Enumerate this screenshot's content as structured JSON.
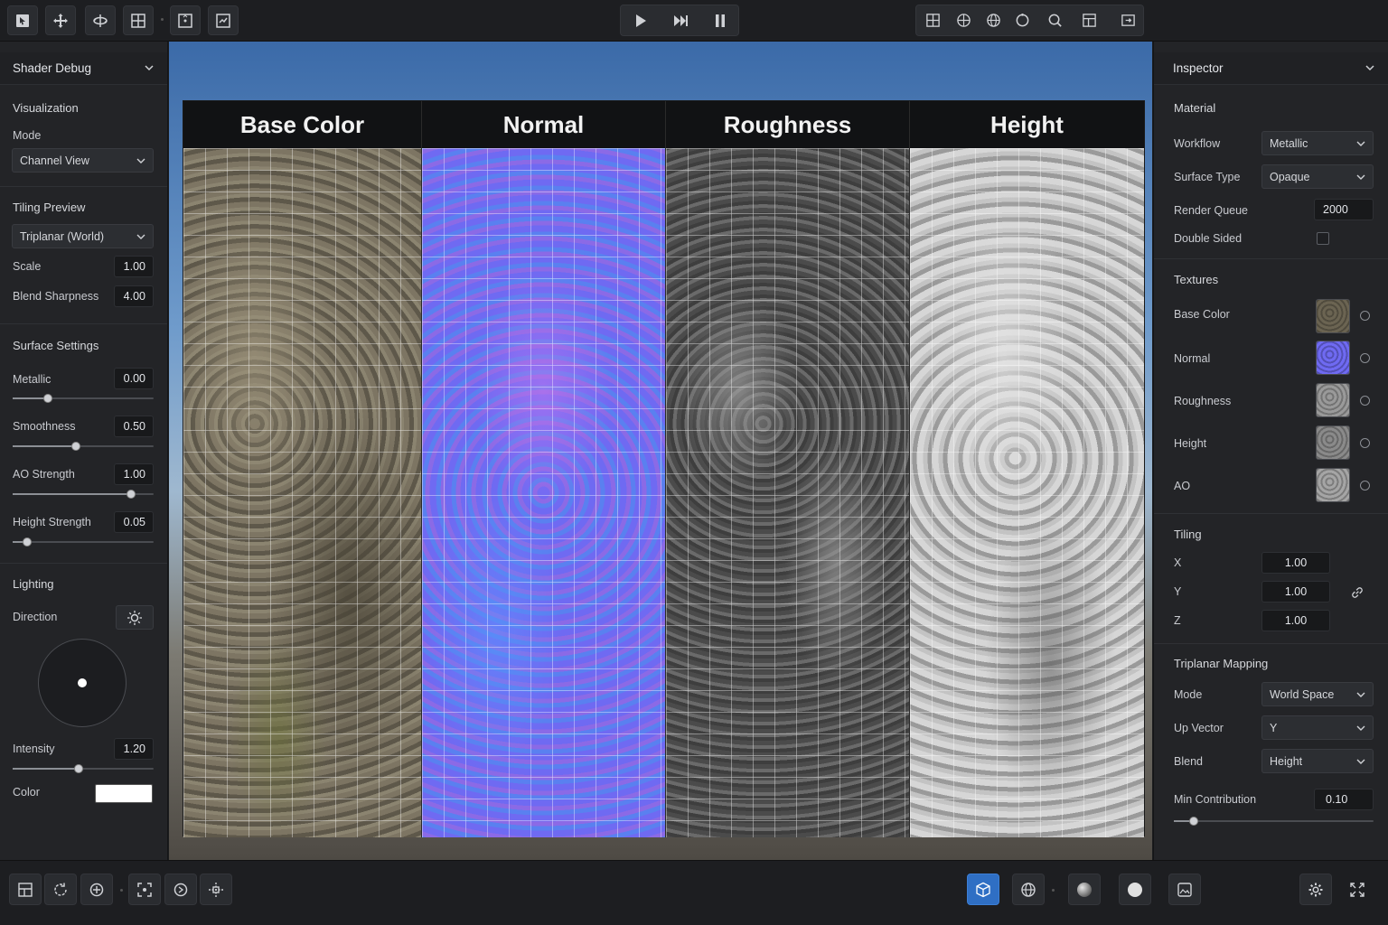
{
  "left_panel": {
    "title": "Shader Debug",
    "visualization": {
      "section": "Visualization",
      "mode_label": "Mode",
      "mode_value": "Channel View"
    },
    "tiling": {
      "section": "Tiling Preview",
      "preview_value": "Triplanar (World)",
      "scale_label": "Scale",
      "scale_value": "1.00",
      "blend_label": "Blend Sharpness",
      "blend_value": "4.00"
    },
    "surface": {
      "section": "Surface Settings",
      "metallic_label": "Metallic",
      "metallic_value": "0.00",
      "metallic_slider": 0.25,
      "smoothness_label": "Smoothness",
      "smoothness_value": "0.50",
      "smoothness_slider": 0.45,
      "ao_label": "AO Strength",
      "ao_value": "1.00",
      "ao_slider": 0.84,
      "height_label": "Height Strength",
      "height_value": "0.05",
      "height_slider": 0.1
    },
    "lighting": {
      "section": "Lighting",
      "direction_label": "Direction",
      "intensity_label": "Intensity",
      "intensity_value": "1.20",
      "intensity_slider": 0.47,
      "color_label": "Color",
      "color_value": "#ffffff"
    }
  },
  "viewport": {
    "channels": [
      "Base Color",
      "Normal",
      "Roughness",
      "Height"
    ]
  },
  "right_panel": {
    "title": "Inspector",
    "material": {
      "section": "Material",
      "workflow_label": "Workflow",
      "workflow_value": "Metallic",
      "surface_label": "Surface Type",
      "surface_value": "Opaque",
      "queue_label": "Render Queue",
      "queue_value": "2000",
      "double_label": "Double Sided",
      "double_checked": false
    },
    "textures": {
      "section": "Textures",
      "items": [
        {
          "label": "Base Color",
          "color": "#6b6452"
        },
        {
          "label": "Normal",
          "color": "#6f6af2"
        },
        {
          "label": "Roughness",
          "color": "#9a9a9a"
        },
        {
          "label": "Height",
          "color": "#8a8a8a"
        },
        {
          "label": "AO",
          "color": "#a5a5a5"
        }
      ]
    },
    "tiling": {
      "section": "Tiling",
      "x_label": "X",
      "x_value": "1.00",
      "y_label": "Y",
      "y_value": "1.00",
      "z_label": "Z",
      "z_value": "1.00"
    },
    "triplanar": {
      "section": "Triplanar Mapping",
      "mode_label": "Mode",
      "mode_value": "World Space",
      "up_label": "Up Vector",
      "up_value": "Y",
      "blend_label": "Blend",
      "blend_value": "Height",
      "min_label": "Min Contribution",
      "min_value": "0.10",
      "min_slider": 0.1
    }
  },
  "colors": {
    "accent": "#2f6fc4",
    "panel_bg": "#232427",
    "toolbar_bg": "#1d1e21"
  },
  "icons": {
    "top_left": [
      "select-icon",
      "move-icon",
      "rotate-icon",
      "scale-icon",
      "rect-tool-icon",
      "transform-icon"
    ],
    "playback": [
      "play-icon",
      "step-icon",
      "pause-icon"
    ],
    "top_right": [
      "grid-icon",
      "globe-icon",
      "sphere-icon",
      "circle-icon",
      "search-icon",
      "layout-icon",
      "export-icon"
    ],
    "bottom_left": [
      "grid-snap-icon",
      "refresh-icon",
      "pivot-icon",
      "frame-icon",
      "target-icon",
      "crosshair-icon"
    ],
    "bottom_center": [
      "cube-icon",
      "world-icon",
      "sphere-shaded-icon",
      "sphere-flat-icon",
      "image-icon"
    ],
    "bottom_right": [
      "settings-icon",
      "fullscreen-icon"
    ]
  }
}
